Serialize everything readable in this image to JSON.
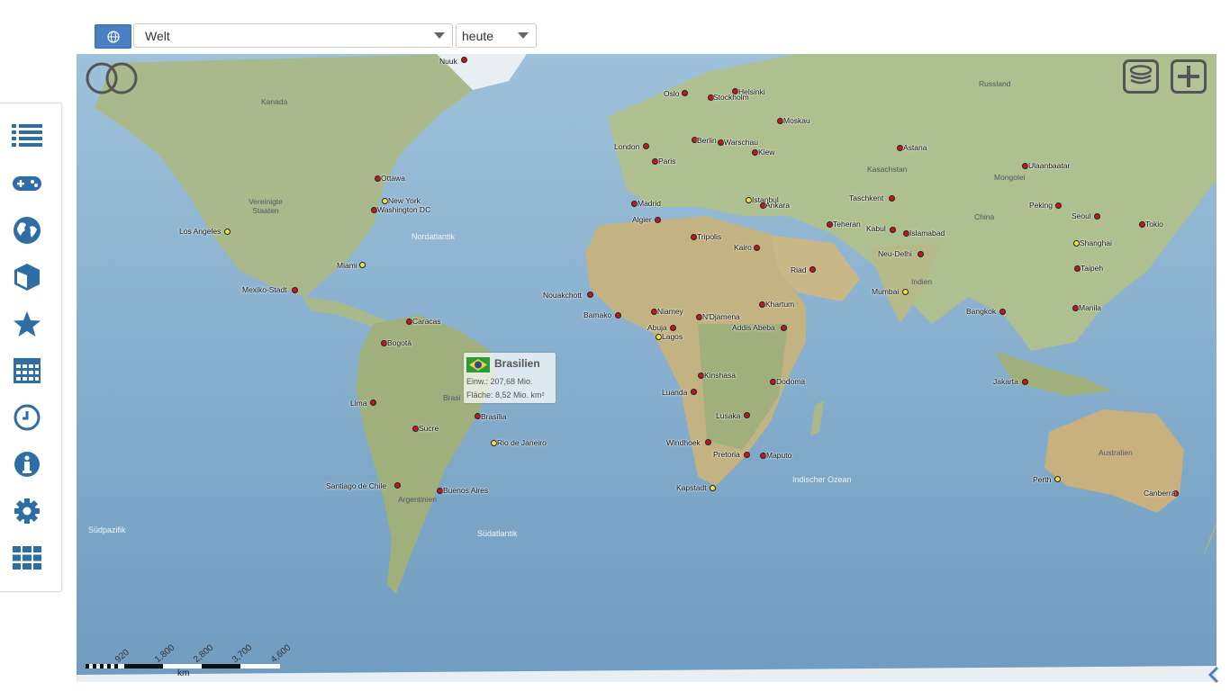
{
  "toolbar": {
    "region_select": "Welt",
    "time_select": "heute"
  },
  "sidebar": {
    "items": [
      {
        "icon": "list-icon"
      },
      {
        "icon": "gamepad-icon"
      },
      {
        "icon": "globe-icon"
      },
      {
        "icon": "cube-icon"
      },
      {
        "icon": "star-icon"
      },
      {
        "icon": "calendar-icon"
      },
      {
        "icon": "clock-icon"
      },
      {
        "icon": "info-icon"
      },
      {
        "icon": "gear-icon"
      },
      {
        "icon": "grid-icon"
      }
    ]
  },
  "map": {
    "cities": [
      "Nuuk",
      "Oslo",
      "Helsinki",
      "Stockholm",
      "Moskau",
      "London",
      "Berlin",
      "Warschau",
      "Kiew",
      "Paris",
      "Madrid",
      "Algier",
      "Istanbul",
      "Ankara",
      "Tripolis",
      "Kairo",
      "Teheran",
      "Astana",
      "Taschkent",
      "Kabul",
      "Islamabad",
      "Neu-Delhi",
      "Ulaanbaatar",
      "Peking",
      "Seoul",
      "Tokio",
      "Shanghai",
      "Taipeh",
      "Manila",
      "Bangkok",
      "Mumbai",
      "Riad",
      "Khartum",
      "Addis Abeba",
      "Jakarta",
      "Ottawa",
      "New York",
      "Washington DC",
      "Los Angeles",
      "Miami",
      "Mexiko-Stadt",
      "Caracas",
      "Bogotá",
      "Lima",
      "Sucre",
      "Brasília",
      "Rio de Janeiro",
      "Santiago de Chile",
      "Buenos Aires",
      "Nouakchott",
      "Bamako",
      "Niamey",
      "Abuja",
      "Lagos",
      "N'Djamena",
      "Kinshasa",
      "Luanda",
      "Dodoma",
      "Lusaka",
      "Windhoek",
      "Pretoria",
      "Maputo",
      "Kapstadt",
      "Perth",
      "Canberra"
    ],
    "regions": [
      "Kanada",
      "Vereinigte Staaten",
      "Russland",
      "Kasachstan",
      "Mongolei",
      "China",
      "Indien",
      "Australien",
      "Argentinien",
      "Brasi"
    ],
    "oceans": [
      "Nordatlantik",
      "Südpazifik",
      "Südatlantik",
      "Indischer Ozean"
    ],
    "tooltip": {
      "country": "Brasilien",
      "population": "Einw.: 207,68 Mio.",
      "area": "Fläche: 8,52 Mio. km²"
    },
    "scale": {
      "ticks": [
        "920",
        "1,800",
        "2,800",
        "3,700",
        "4,600"
      ],
      "unit": "km"
    }
  },
  "colors": {
    "accent": "#2f6ea5",
    "capital_dot": "#c4161c",
    "city_dot": "#f2e33a"
  }
}
